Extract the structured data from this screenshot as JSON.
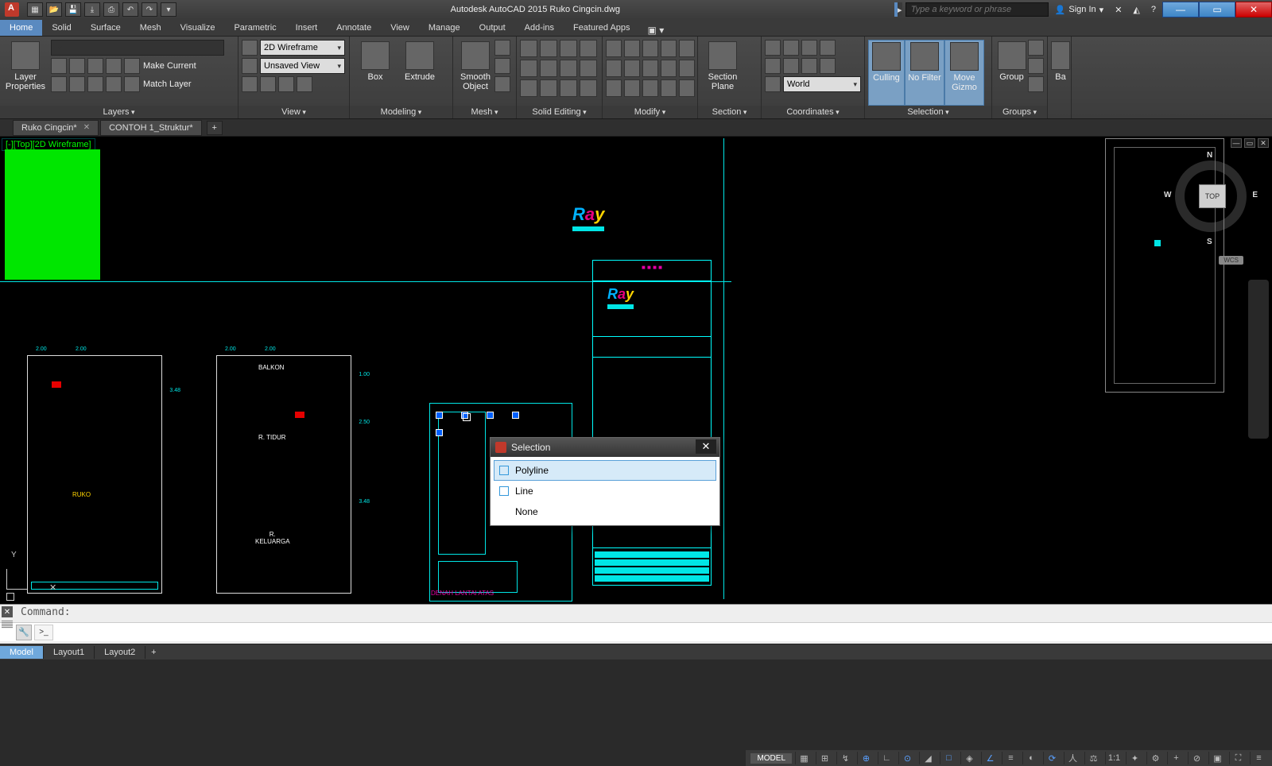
{
  "app": {
    "title": "Autodesk AutoCAD 2015    Ruko Cingcin.dwg",
    "search_placeholder": "Type a keyword or phrase",
    "sign_in": "Sign In"
  },
  "quick_access": [
    "New",
    "Open",
    "Save",
    "Undo",
    "Redo",
    "Print"
  ],
  "menu_tabs": [
    "Home",
    "Solid",
    "Surface",
    "Mesh",
    "Visualize",
    "Parametric",
    "Insert",
    "Annotate",
    "View",
    "Manage",
    "Output",
    "Add-ins",
    "Featured Apps"
  ],
  "active_menu_tab": "Home",
  "ribbon": {
    "layers": {
      "title": "Layers",
      "big": "Layer\nProperties",
      "combo_layer": "",
      "make_current": "Make Current",
      "match_layer": "Match Layer"
    },
    "view": {
      "title": "View",
      "style_combo": "2D Wireframe",
      "view_combo": "Unsaved View"
    },
    "modeling": {
      "title": "Modeling",
      "box": "Box",
      "extrude": "Extrude"
    },
    "mesh": {
      "title": "Mesh",
      "smooth": "Smooth\nObject"
    },
    "solid_editing": {
      "title": "Solid Editing"
    },
    "modify": {
      "title": "Modify"
    },
    "section": {
      "title": "Section",
      "plane": "Section\nPlane"
    },
    "coordinates": {
      "title": "Coordinates",
      "world": "World"
    },
    "selection": {
      "title": "Selection",
      "culling": "Culling",
      "no_filter": "No Filter",
      "gizmo": "Move\nGizmo"
    },
    "groups": {
      "title": "Groups",
      "group": "Group"
    },
    "extra": {
      "ba": "Ba"
    }
  },
  "doc_tabs": [
    {
      "label": "Ruko Cingcin*",
      "active": true
    },
    {
      "label": "CONTOH 1_Struktur*",
      "active": false
    }
  ],
  "viewport": {
    "label": "[-][Top][2D Wireframe]",
    "viewcube_face": "TOP",
    "wcs": "WCS",
    "directions": {
      "n": "N",
      "e": "E",
      "s": "S",
      "w": "W"
    },
    "ucs_y": "Y"
  },
  "floorplans": {
    "fp1": {
      "label": "RUKO",
      "dims": [
        "2.00",
        "2.00",
        "3.48"
      ]
    },
    "fp2": {
      "label_top": "BALKON",
      "label_mid": "R. TIDUR",
      "label_bot": "R.\nKELUARGA",
      "dims": [
        "2.00",
        "2.00",
        "3.48",
        "1.00",
        "2.50"
      ]
    },
    "fp3_note": "DENAH LANTAI ATAS"
  },
  "title_block": {
    "header": ""
  },
  "selection_popup": {
    "title": "Selection",
    "items": [
      "Polyline",
      "Line",
      "None"
    ],
    "selected_index": 0
  },
  "command": {
    "recent": "Command:",
    "prompt_icon": ">_",
    "input_value": ""
  },
  "layout_tabs": [
    "Model",
    "Layout1",
    "Layout2"
  ],
  "active_layout": "Model",
  "status": {
    "model": "MODEL",
    "scale": "1:1",
    "toggles": [
      "grid",
      "snap",
      "infer",
      "dyn",
      "ortho",
      "polar",
      "iso",
      "osnap",
      "3dosnap",
      "otrack",
      "lweight",
      "trans",
      "cycle",
      "qprops",
      "units",
      "gizmo",
      "filter",
      "hardware",
      "isolate",
      "clean"
    ]
  }
}
